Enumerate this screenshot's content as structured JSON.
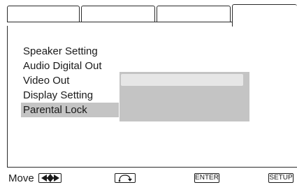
{
  "menu": {
    "items": [
      {
        "label": "Speaker Setting"
      },
      {
        "label": "Audio Digital Out"
      },
      {
        "label": "Video Out"
      },
      {
        "label": "Display Setting"
      },
      {
        "label": "Parental Lock"
      }
    ],
    "selected_index": 4
  },
  "guide": {
    "move_label": "Move",
    "move_icon": "four-direction-arrows-icon",
    "return_icon": "return-arrow-icon",
    "enter_label": "ENTER",
    "setup_label": "SETUP"
  },
  "colors": {
    "highlight": "#c4c4c4",
    "subpanel_bar": "#e6e6e6"
  }
}
